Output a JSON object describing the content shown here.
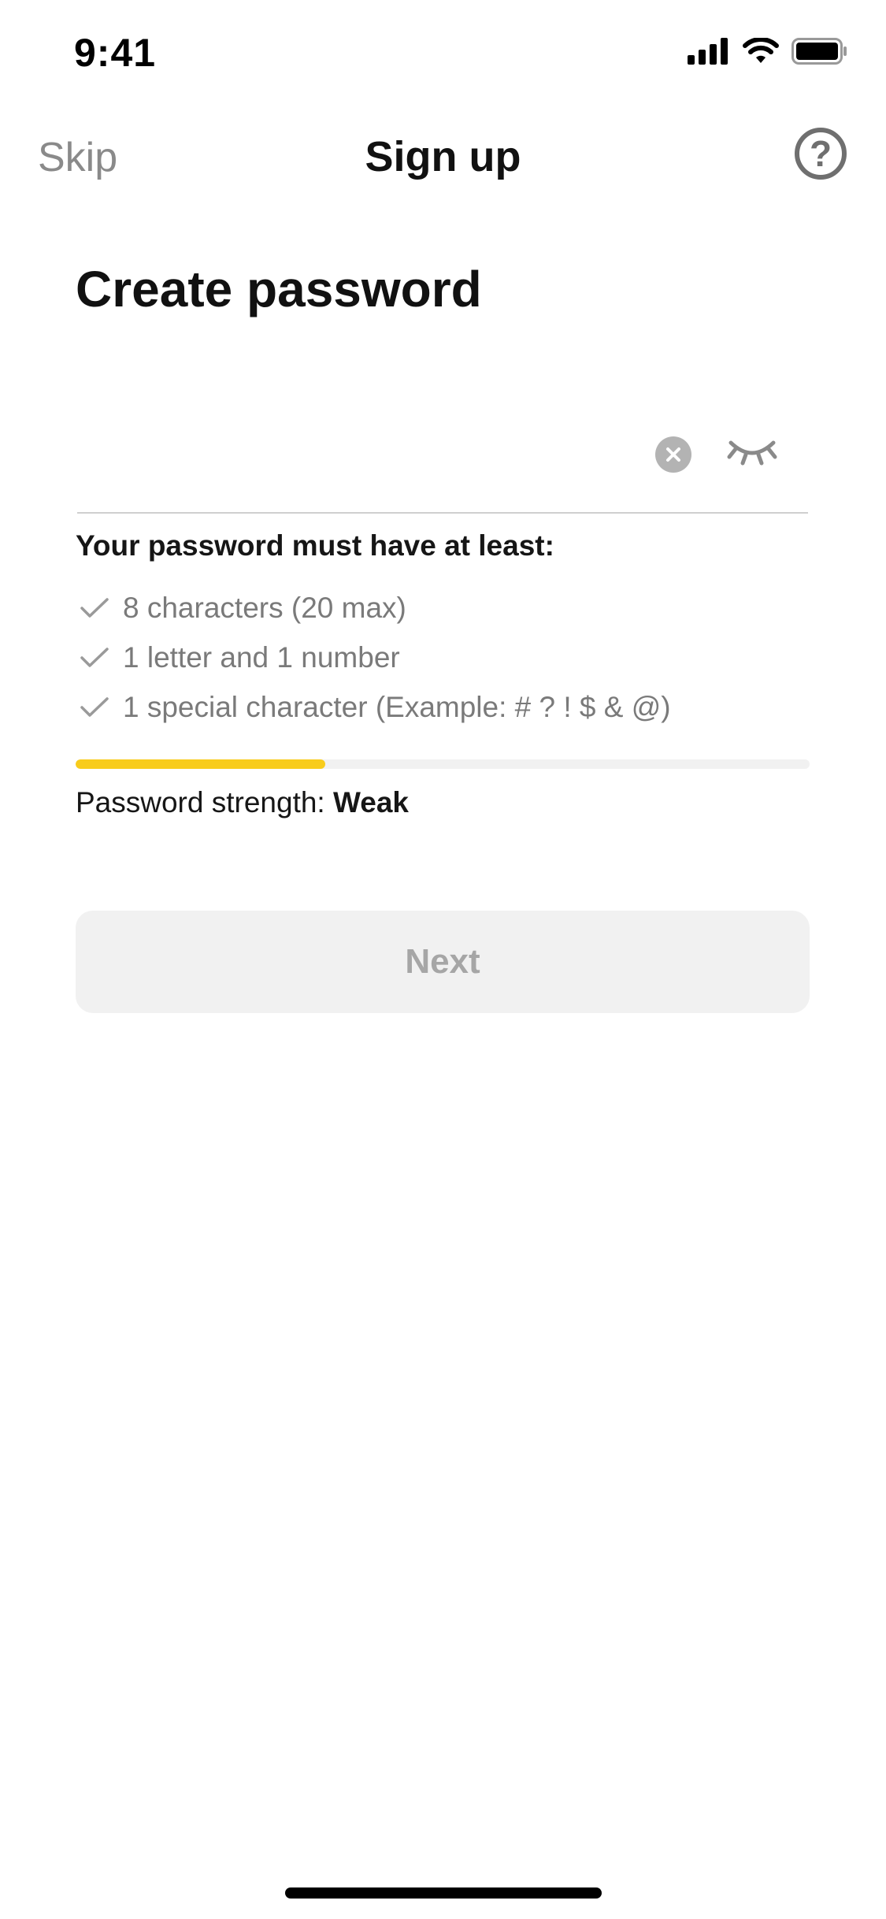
{
  "status_bar": {
    "time": "9:41",
    "icons": [
      "cellular-signal-icon",
      "wifi-icon",
      "battery-icon"
    ]
  },
  "nav": {
    "skip_label": "Skip",
    "title": "Sign up",
    "help_icon": "help-circle-icon",
    "help_glyph": "?"
  },
  "page": {
    "heading": "Create password"
  },
  "password_field": {
    "value": "",
    "placeholder": "",
    "clear_icon": "clear-icon",
    "visibility_icon": "eye-closed-icon"
  },
  "requirements": {
    "heading": "Your password must have at least:",
    "items": [
      {
        "text": "8 characters (20 max)",
        "icon": "check-icon"
      },
      {
        "text": "1 letter and 1 number",
        "icon": "check-icon"
      },
      {
        "text": "1 special character (Example: # ? ! $ & @)",
        "icon": "check-icon"
      }
    ]
  },
  "strength": {
    "label": "Password strength: ",
    "value": "Weak",
    "level_fraction": 0.34,
    "fill_color": "#f8cc1b",
    "track_color": "#f1f1f1"
  },
  "next_button": {
    "label": "Next",
    "enabled": false
  },
  "colors": {
    "accent": "#f8cc1b",
    "muted_text": "#7a7a7a",
    "disabled_button_bg": "#f1f1f1",
    "disabled_button_text": "#a6a6a6"
  }
}
